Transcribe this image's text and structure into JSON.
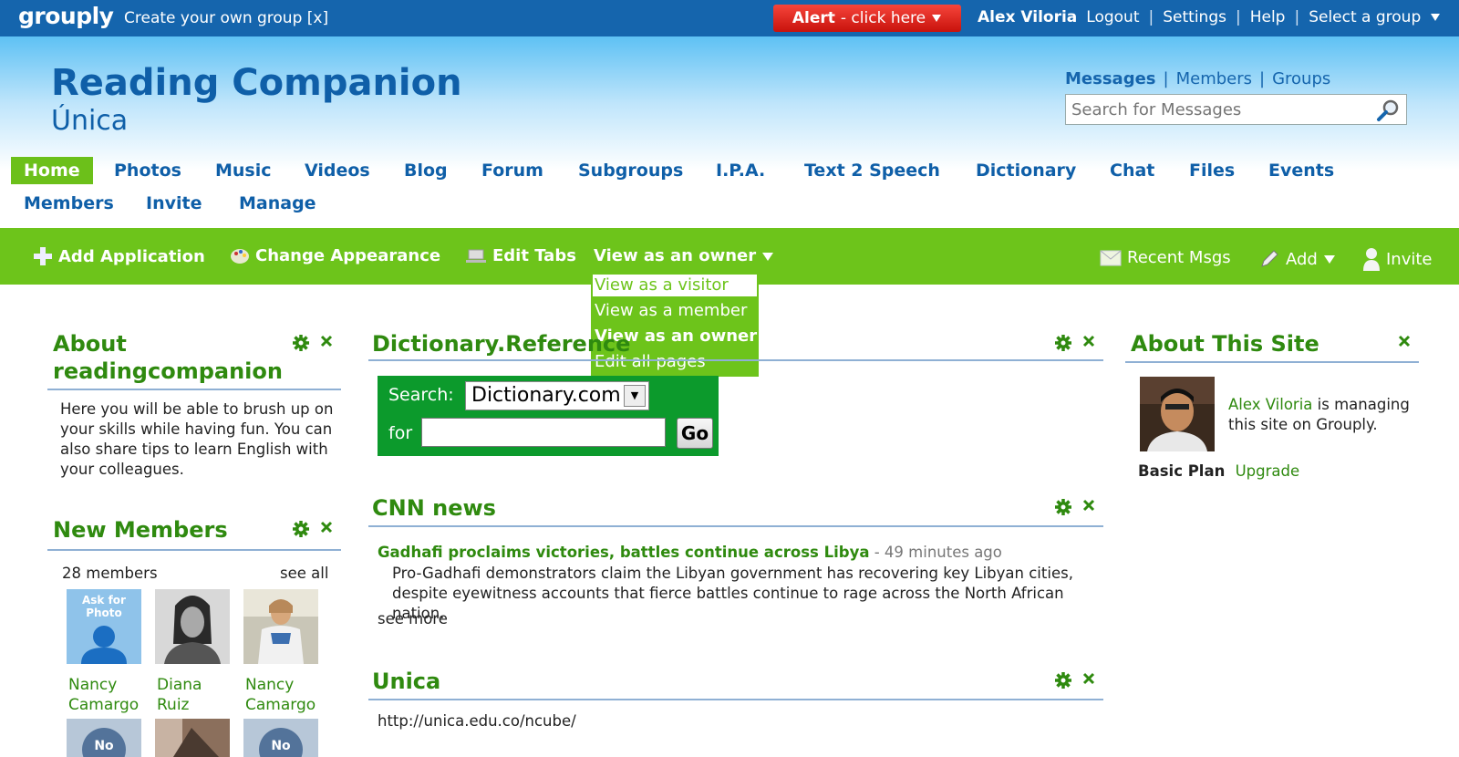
{
  "topbar": {
    "logo": "grouply",
    "create_link": "Create your own group [x]",
    "alert_bold": "Alert",
    "alert_rest": "- click here",
    "user": "Alex Viloria",
    "links": [
      "Logout",
      "Settings",
      "Help",
      "Select a group"
    ]
  },
  "header": {
    "title": "Reading Companion",
    "subtitle": "Única",
    "search_tabs": [
      "Messages",
      "Members",
      "Groups"
    ],
    "search_placeholder": "Search for Messages"
  },
  "nav": [
    "Home",
    "Photos",
    "Music",
    "Videos",
    "Blog",
    "Forum",
    "Subgroups",
    "I.P.A.",
    "Text 2 Speech",
    "Dictionary",
    "Chat",
    "Files",
    "Events",
    "Members",
    "Invite",
    "Manage"
  ],
  "toolbar": {
    "add_application": "Add Application",
    "change_appearance": "Change Appearance",
    "edit_tabs": "Edit Tabs",
    "view_as": "View as an owner",
    "recent_msgs": "Recent Msgs",
    "add": "Add",
    "invite": "Invite"
  },
  "view_menu": [
    "View as a visitor",
    "View as a member",
    "View as an owner",
    "Edit all pages"
  ],
  "about": {
    "title_line1": "About",
    "title_line2": "readingcompanion",
    "body": "Here you will be able to brush up on your skills while having fun.  You can also share tips to learn English with your colleagues."
  },
  "new_members": {
    "title": "New Members",
    "count": "28 members",
    "see_all": "see all",
    "ask_photo": "Ask for Photo",
    "no_photo": "No",
    "members": [
      {
        "first": "Nancy",
        "last": "Camargo"
      },
      {
        "first": "Diana",
        "last": "Ruiz"
      },
      {
        "first": "Nancy",
        "last": "Camargo"
      }
    ]
  },
  "dictionary": {
    "title": "Dictionary.Reference",
    "search_label": "Search:",
    "selected": "Dictionary.com",
    "for_label": "for",
    "go": "Go"
  },
  "cnn": {
    "title": "CNN news",
    "headline": "Gadhafi proclaims victories, battles continue across Libya",
    "time": "- 49 minutes ago",
    "summary": "Pro-Gadhafi demonstrators claim the Libyan government has recovering key Libyan cities, despite eyewitness accounts that fierce battles continue to rage across the North African nation.",
    "see_more": "see more"
  },
  "unica": {
    "title": "Unica",
    "link": "http://unica.edu.co/ncube/"
  },
  "about_site": {
    "title": "About This Site",
    "manager": "Alex Viloria",
    "managing_text": "is managing this site on Grouply.",
    "plan": "Basic Plan",
    "upgrade": "Upgrade"
  },
  "colors": {
    "topbar": "#1565ad",
    "green": "#6dc41b",
    "title_blue": "#0f5fa8",
    "link_green": "#2f8a0f",
    "alert_red": "#e0231b"
  }
}
